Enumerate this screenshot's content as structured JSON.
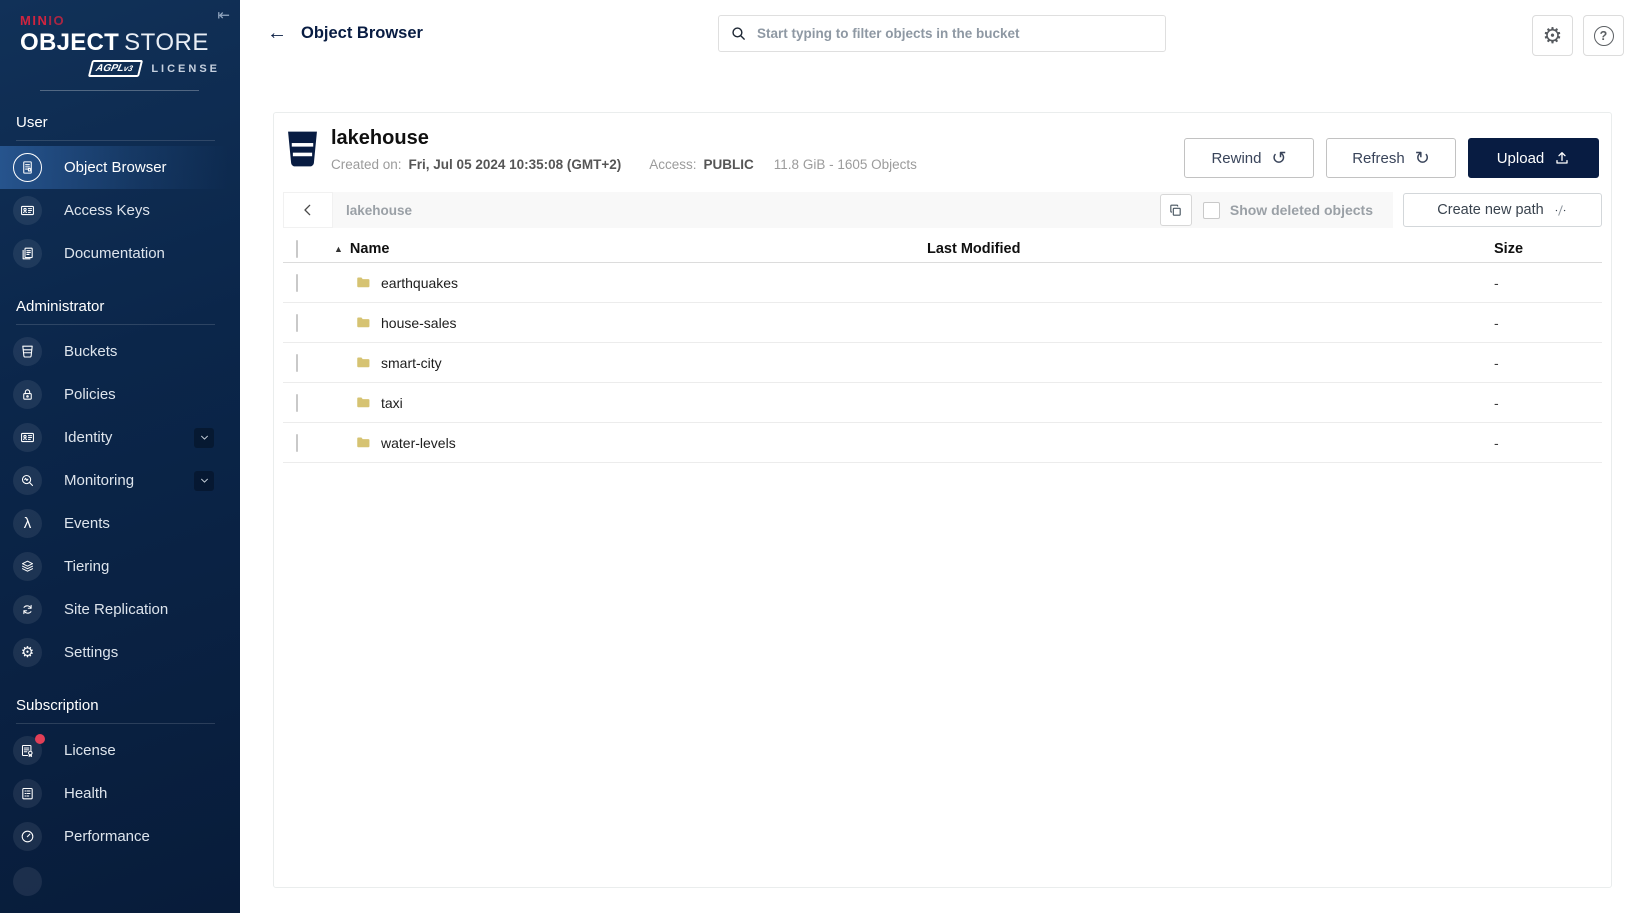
{
  "brand": {
    "minio_prefix": "MIN",
    "minio_suffix": "IO",
    "product_bold": "OBJECT",
    "product_light": "STORE",
    "badge_text": "AGPL",
    "badge_sub": "v3",
    "license_text": "LICENSE"
  },
  "icons": {
    "collapse": "⇤",
    "back_arrow": "←",
    "sort_asc": "▲",
    "rewind": "↺",
    "refresh": "↻",
    "gear": "⚙",
    "lambda": "λ",
    "help": "?"
  },
  "sidebar": {
    "sections": [
      {
        "label": "User",
        "items": [
          {
            "label": "Object Browser",
            "icon": "object-browser-icon",
            "active": true
          },
          {
            "label": "Access Keys",
            "icon": "access-keys-icon"
          },
          {
            "label": "Documentation",
            "icon": "documentation-icon"
          }
        ]
      },
      {
        "label": "Administrator",
        "items": [
          {
            "label": "Buckets",
            "icon": "buckets-icon"
          },
          {
            "label": "Policies",
            "icon": "policies-icon"
          },
          {
            "label": "Identity",
            "icon": "identity-icon",
            "expandable": true
          },
          {
            "label": "Monitoring",
            "icon": "monitoring-icon",
            "expandable": true
          },
          {
            "label": "Events",
            "icon": "events-icon"
          },
          {
            "label": "Tiering",
            "icon": "tiering-icon"
          },
          {
            "label": "Site Replication",
            "icon": "site-replication-icon"
          },
          {
            "label": "Settings",
            "icon": "settings-icon"
          }
        ]
      },
      {
        "label": "Subscription",
        "items": [
          {
            "label": "License",
            "icon": "license-icon",
            "notification": true
          },
          {
            "label": "Health",
            "icon": "health-icon"
          },
          {
            "label": "Performance",
            "icon": "performance-icon"
          }
        ]
      }
    ]
  },
  "header": {
    "title": "Object Browser",
    "search_placeholder": "Start typing to filter objects in the bucket"
  },
  "bucket": {
    "name": "lakehouse",
    "created_label": "Created on:",
    "created_value": "Fri, Jul 05 2024 10:35:08 (GMT+2)",
    "access_label": "Access:",
    "access_value": "PUBLIC",
    "stats": "11.8 GiB - 1605 Objects",
    "rewind_label": "Rewind",
    "refresh_label": "Refresh",
    "upload_label": "Upload"
  },
  "browser": {
    "current_path": "lakehouse",
    "show_deleted_label": "Show deleted objects",
    "create_path_label": "Create new path"
  },
  "table": {
    "col_name": "Name",
    "col_modified": "Last Modified",
    "col_size": "Size",
    "rows": [
      {
        "name": "earthquakes",
        "modified": "",
        "size": "-"
      },
      {
        "name": "house-sales",
        "modified": "",
        "size": "-"
      },
      {
        "name": "smart-city",
        "modified": "",
        "size": "-"
      },
      {
        "name": "taxi",
        "modified": "",
        "size": "-"
      },
      {
        "name": "water-levels",
        "modified": "",
        "size": "-"
      }
    ]
  },
  "colors": {
    "accent_navy": "#081C42",
    "brand_red": "#D0243F",
    "folder_tan": "#D6C372",
    "notification_red": "#E23F57",
    "sidebar_top": "#113158",
    "sidebar_bottom": "#081c3a"
  }
}
